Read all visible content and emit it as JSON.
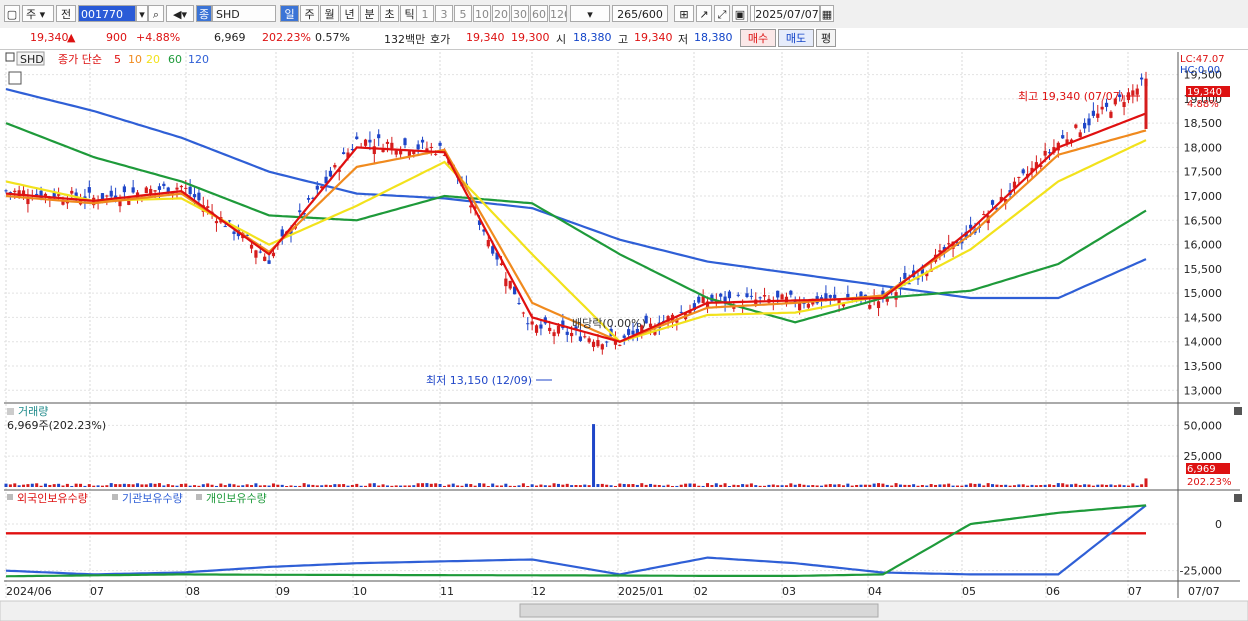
{
  "toolbar": {
    "market": "주",
    "prev": "전",
    "code": "001770",
    "type_badge": "종",
    "name": "SHD",
    "periods": [
      "일",
      "주",
      "월",
      "년",
      "분",
      "초",
      "틱"
    ],
    "intervals": [
      "1",
      "3",
      "5",
      "10",
      "20",
      "30",
      "60",
      "120"
    ],
    "count": "265",
    "count_total": "/600",
    "date": "2025/07/07"
  },
  "quote": {
    "price": "19,340",
    "arrow": "▲",
    "change": "900",
    "change_pct": "+4.88%",
    "volume": "6,969",
    "vol_ratio": "202.23%",
    "turnover": "0.57%",
    "amount": "132백만",
    "ask_label": "호가",
    "ask": "19,340",
    "bid": "19,300",
    "open_label": "시",
    "open": "18,380",
    "high_label": "고",
    "high": "19,340",
    "low_label": "저",
    "low": "18,380",
    "buy": "매수",
    "sell": "매도",
    "eval": "평"
  },
  "main_legend": {
    "symbol": "SHD",
    "label": "종가 단순",
    "ma": [
      "5",
      "10",
      "20",
      "60",
      "120"
    ]
  },
  "annotations": {
    "high": "최고 19,340 (07/07)",
    "low": "최저 13,150 (12/09)",
    "dividend": "배당락(0.00%)"
  },
  "right_info": {
    "lc": "LC:47.07",
    "hc": "HC:0.00",
    "last_price": "19,340",
    "last_pct": "4.88%"
  },
  "volume_panel": {
    "title": "거래량",
    "subtitle": "6,969주(202.23%)",
    "ticks": [
      "50,000",
      "25,000"
    ],
    "last": "6,969",
    "last_pct": "202.23%"
  },
  "holding_panel": {
    "legend": [
      "외국인보유수량",
      "기관보유수량",
      "개인보유수량"
    ],
    "ticks": [
      "0",
      "-25,000"
    ]
  },
  "x_axis": {
    "labels": [
      "2024/06",
      "07",
      "08",
      "09",
      "10",
      "11",
      "12",
      "2025/01",
      "02",
      "03",
      "04",
      "05",
      "06",
      "07"
    ],
    "right": "07/07"
  },
  "colors": {
    "ma5": "#e01010",
    "ma10": "#f08a1e",
    "ma20": "#f2e21c",
    "ma60": "#1e9a3a",
    "ma120": "#2f5fd6",
    "up": "#d51d1d",
    "down": "#1f46c8"
  },
  "chart_data": [
    {
      "type": "line",
      "name": "price",
      "title": "",
      "ylim": [
        12800,
        19800
      ],
      "ticks": [
        13000,
        13500,
        14000,
        14500,
        15000,
        15500,
        16000,
        16500,
        17000,
        17500,
        18000,
        18500,
        19000,
        19500
      ],
      "x_dates": [
        "2024/06",
        "2024/07",
        "2024/08",
        "2024/09",
        "2024/10",
        "2024/11",
        "2024/12",
        "2025/01",
        "2025/02",
        "2025/03",
        "2025/04",
        "2025/05",
        "2025/06",
        "2025/07"
      ],
      "series": [
        {
          "name": "종가",
          "values": [
            17100,
            16950,
            17200,
            15700,
            18150,
            17950,
            14300,
            14000,
            14850,
            14850,
            14850,
            16250,
            18100,
            19340
          ]
        },
        {
          "name": "5",
          "values": [
            17050,
            16900,
            17100,
            15800,
            18000,
            17900,
            14500,
            14000,
            14800,
            14850,
            14900,
            16300,
            18000,
            18700
          ]
        },
        {
          "name": "10",
          "values": [
            17000,
            16850,
            17050,
            15850,
            17600,
            17950,
            14800,
            14000,
            14700,
            14800,
            14950,
            16200,
            17850,
            18350
          ]
        },
        {
          "name": "20",
          "values": [
            17300,
            16900,
            16950,
            16000,
            16800,
            17700,
            15800,
            14000,
            14550,
            14600,
            14950,
            15900,
            17300,
            18150
          ]
        },
        {
          "name": "60",
          "values": [
            18500,
            17800,
            17300,
            16600,
            16500,
            17000,
            16850,
            15800,
            14900,
            14400,
            14900,
            15050,
            15600,
            16700
          ]
        },
        {
          "name": "120",
          "values": [
            19200,
            18750,
            18200,
            17500,
            17050,
            16950,
            16750,
            16100,
            15650,
            15400,
            15150,
            14900,
            14900,
            15700
          ]
        }
      ]
    },
    {
      "type": "bar",
      "name": "volume",
      "ylim": [
        0,
        60000
      ],
      "ticks": [
        25000,
        50000
      ],
      "peak": {
        "date": "2024/12",
        "value": 51000
      },
      "last": 6969
    },
    {
      "type": "line",
      "name": "holdings",
      "ylim": [
        -30000,
        15000
      ],
      "ticks": [
        0,
        -25000
      ],
      "series": [
        {
          "name": "외국인보유수량",
          "values": [
            -5000,
            -5000,
            -5000,
            -5000,
            -5000,
            -5000,
            -5000,
            -5000,
            -5000,
            -5000,
            -5000,
            -5000,
            -5000,
            -5000
          ]
        },
        {
          "name": "기관보유수량",
          "values": [
            -25000,
            -27000,
            -26000,
            -23000,
            -21000,
            -20000,
            -19000,
            -27000,
            -18000,
            -21000,
            -26000,
            -27000,
            -27000,
            10000
          ]
        },
        {
          "name": "개인보유수량",
          "values": [
            -28000,
            -27500,
            -27000,
            -27200,
            -27300,
            -27400,
            -27500,
            -27600,
            -27800,
            -27800,
            -27000,
            0,
            6000,
            10000
          ]
        }
      ]
    }
  ]
}
